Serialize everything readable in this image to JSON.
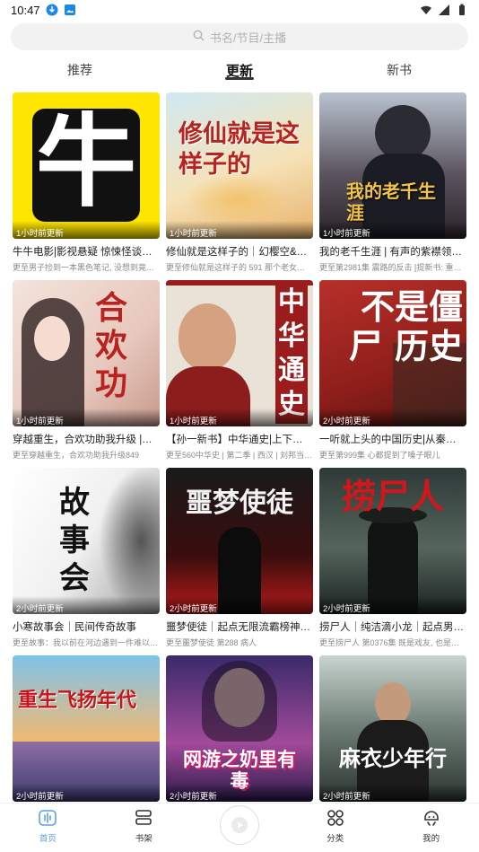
{
  "status": {
    "time": "10:47"
  },
  "search": {
    "placeholder": "书名/节目/主播"
  },
  "tabs": [
    {
      "label": "推荐"
    },
    {
      "label": "更新"
    },
    {
      "label": "新书"
    }
  ],
  "cards": [
    {
      "cover_text": "牛",
      "badge": "1小时前更新",
      "title": "牛牛电影|影视悬疑 惊悚怪谈…",
      "subtitle": "更至男子捡到一本黑色笔记, 没想到竟…"
    },
    {
      "cover_text": "修仙就是这样子的",
      "badge": "1小时前更新",
      "title": "修仙就是这样子的｜幻樱空&…",
      "subtitle": "更至修仙就是这样子的 591 那个老女人…"
    },
    {
      "cover_text": "我的老千生涯",
      "badge": "1小时前更新",
      "title": "我的老千生涯 | 有声的紫襟领…",
      "subtitle": "更至第2981集 震路的反击 [提新书: 重…"
    },
    {
      "cover_text": "合欢功",
      "badge": "1小时前更新",
      "title": "穿越重生，合欢功助我升级 |…",
      "subtitle": "更至穿越重生，合欢功助我升级849"
    },
    {
      "cover_text": "中华通史",
      "badge": "1小时前更新",
      "title": "【孙一新书】中华通史|上下…",
      "subtitle": "更至560中华史 | 第二季 | 西汉 | 刘邦当…"
    },
    {
      "cover_text": "不是僵尸 历史",
      "badge": "2小时前更新",
      "title": "一听就上头的中国历史|从秦…",
      "subtitle": "更至第999集 心都提到了嗓子眼儿"
    },
    {
      "cover_text": "故事会",
      "badge": "2小时前更新",
      "title": "小寒故事会｜民间传奇故事",
      "subtitle": "更至故事：我以前在河边遇到一件难以…"
    },
    {
      "cover_text": "噩梦使徒",
      "badge": "2小时前更新",
      "title": "噩梦使徒｜起点无限流霸榜神…",
      "subtitle": "更至噩梦使徒 第288 病人"
    },
    {
      "cover_text": "捞尸人",
      "badge": "2小时前更新",
      "title": "捞尸人｜纯洁滴小龙｜起点男…",
      "subtitle": "更至捞尸人 第0376集 既是戏友, 也是病…"
    },
    {
      "cover_text": "重生飞扬年代",
      "badge": "2小时前更新",
      "title": "",
      "subtitle": ""
    },
    {
      "cover_text": "网游之奶里有毒",
      "badge": "2小时前更新",
      "title": "",
      "subtitle": ""
    },
    {
      "cover_text": "麻衣少年行",
      "badge": "2小时前更新",
      "title": "",
      "subtitle": ""
    }
  ],
  "nav": [
    {
      "label": "首页",
      "icon": "home-icon"
    },
    {
      "label": "书架",
      "icon": "bookshelf-icon"
    },
    {
      "label": "",
      "icon": "play-icon"
    },
    {
      "label": "分类",
      "icon": "category-icon"
    },
    {
      "label": "我的",
      "icon": "profile-icon"
    }
  ],
  "colors": {
    "accent": "#5aa0e8"
  }
}
